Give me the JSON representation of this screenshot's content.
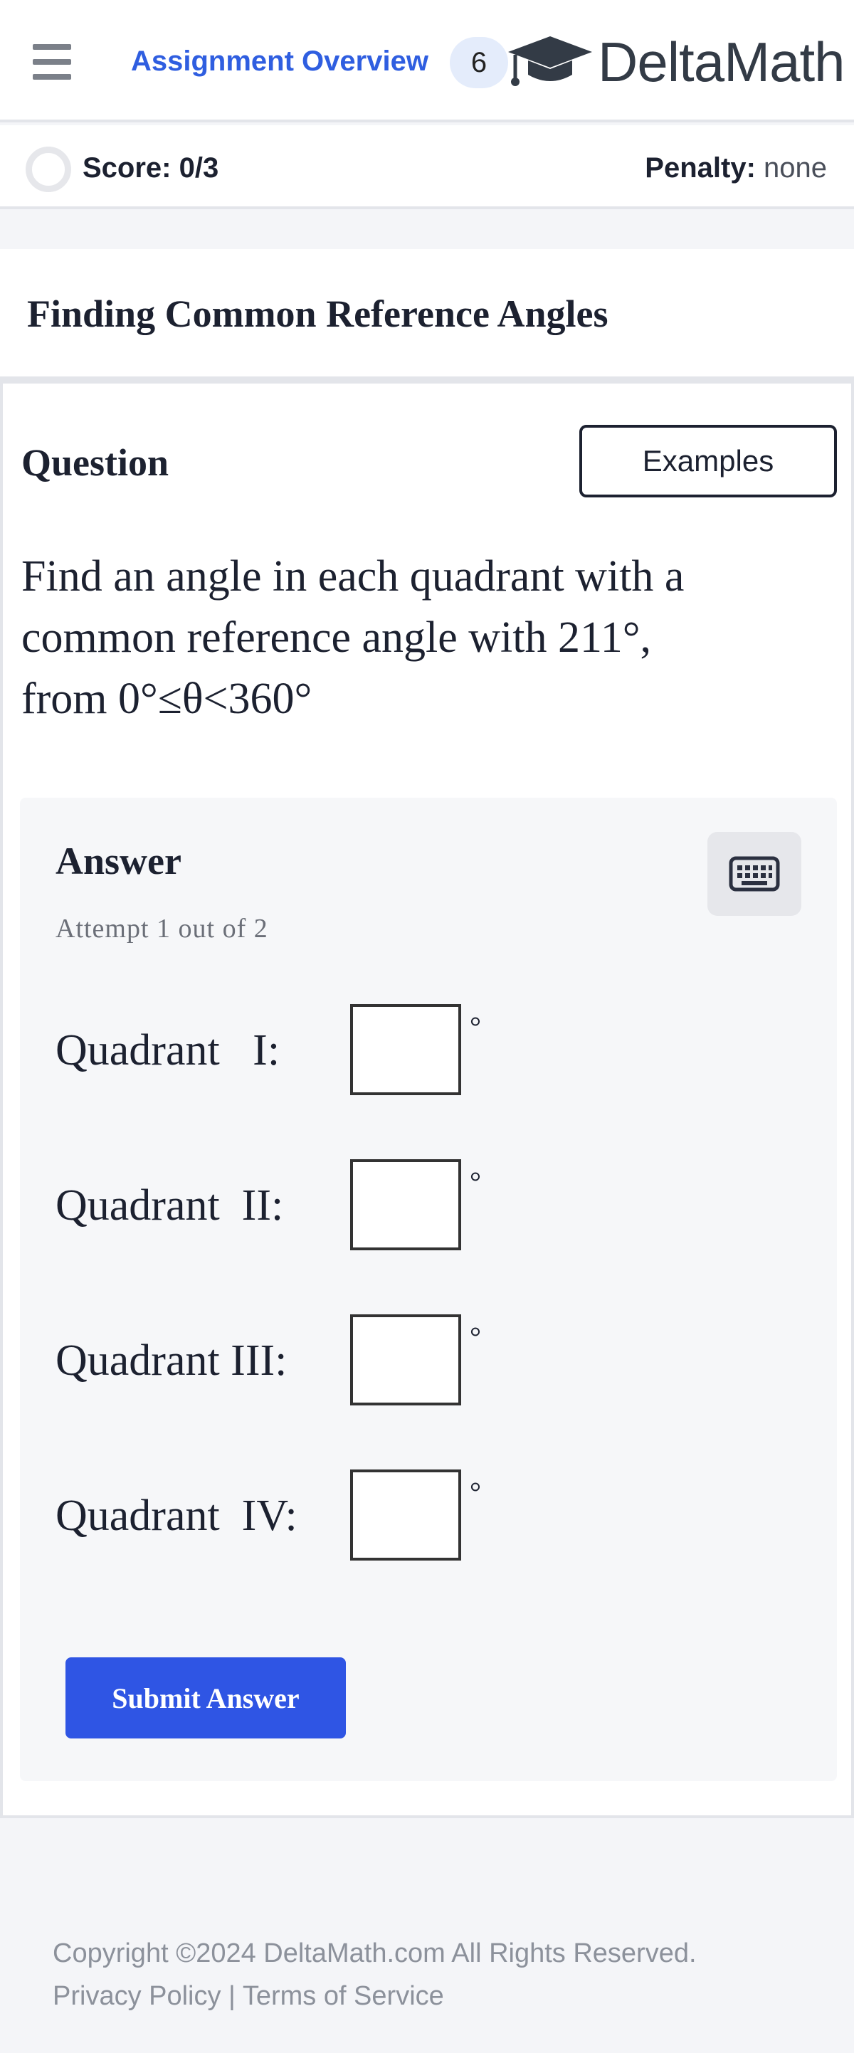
{
  "header": {
    "assignment_link": "Assignment Overview",
    "badge_count": "6",
    "logo_text": "DeltaMath",
    "menu_icon": "hamburger-menu-icon",
    "logo_icon": "graduation-cap-icon"
  },
  "scorebar": {
    "score": "Score: 0/3",
    "penalty_label": "Penalty:",
    "penalty_value": "none"
  },
  "title": "Finding Common Reference Angles",
  "question": {
    "heading": "Question",
    "examples_button": "Examples",
    "text_line1": "Find an angle in each quadrant with a",
    "text_line2": "common reference angle with 211°,",
    "text_line3": "from 0°≤θ<360°"
  },
  "answer": {
    "heading": "Answer",
    "attempt": "Attempt 1 out of 2",
    "keyboard_icon": "keyboard-icon",
    "rows": [
      {
        "label": "Quadrant   I:",
        "value": "",
        "unit": "°"
      },
      {
        "label": "Quadrant  II:",
        "value": "",
        "unit": "°"
      },
      {
        "label": "Quadrant III:",
        "value": "",
        "unit": "°"
      },
      {
        "label": "Quadrant  IV:",
        "value": "",
        "unit": "°"
      }
    ],
    "submit_button": "Submit Answer"
  },
  "footer": {
    "copyright": "Copyright ©2024 DeltaMath.com All Rights Reserved.",
    "privacy": "Privacy Policy",
    "separator": " | ",
    "terms": "Terms of Service"
  },
  "colors": {
    "accent_blue": "#2f5ee0",
    "submit_blue": "#2f55e4",
    "badge_bg": "#e4ecfb",
    "page_bg": "#f4f5f8"
  }
}
